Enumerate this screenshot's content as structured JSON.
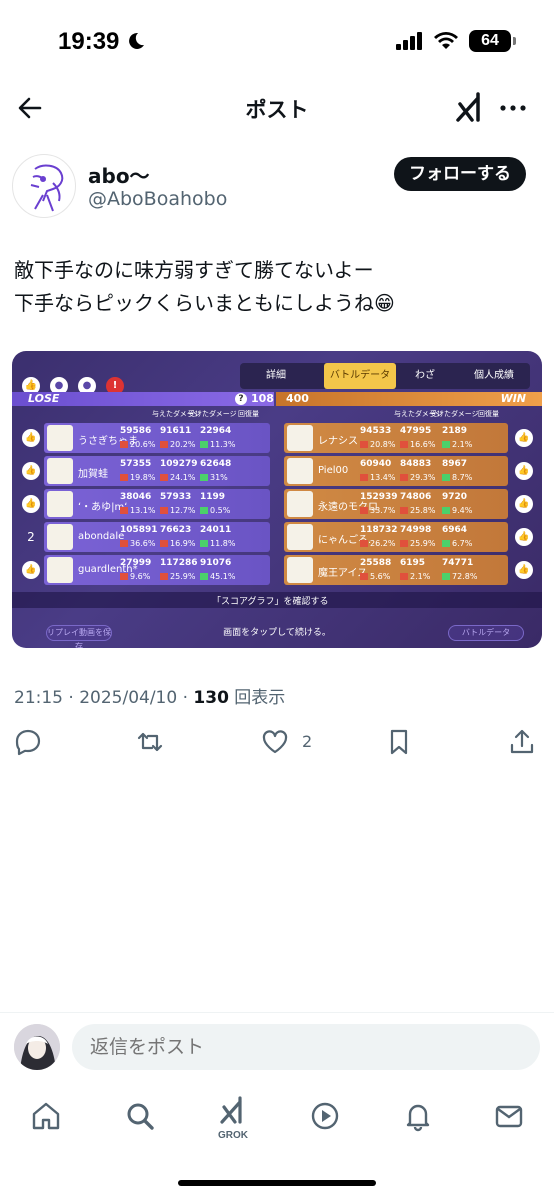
{
  "status": {
    "time": "19:39",
    "battery": "64"
  },
  "nav": {
    "title": "ポスト"
  },
  "author": {
    "name": "abo～",
    "handle": "@AboBoahobo",
    "follow_label": "フォローする"
  },
  "post": {
    "lines": [
      "敵下手なのに味方弱すぎて勝てないよー",
      "下手ならピックくらいまともにしようね😁"
    ]
  },
  "game": {
    "tabs": [
      "詳細",
      "バトルデータ",
      "わざ",
      "個人成績"
    ],
    "lose_label": "LOSE",
    "lose_score": "108",
    "win_score": "400",
    "win_label": "WIN",
    "col_headers": [
      "与えたダメージ",
      "受けたダメージ",
      "回復量"
    ],
    "lose_rows": [
      {
        "name": "うさぎちゃま",
        "v": [
          "59586",
          "91611",
          "22964"
        ],
        "p": [
          "20.6%",
          "20.2%",
          "11.3%"
        ]
      },
      {
        "name": "加賀蛙",
        "v": [
          "57355",
          "109279",
          "62648"
        ],
        "p": [
          "19.8%",
          "24.1%",
          "31%"
        ]
      },
      {
        "name": "ʻ・あゆ|mʻ",
        "v": [
          "38046",
          "57933",
          "1199"
        ],
        "p": [
          "13.1%",
          "12.7%",
          "0.5%"
        ]
      },
      {
        "name": "abondale",
        "v": [
          "105891",
          "76623",
          "24011"
        ],
        "p": [
          "36.6%",
          "16.9%",
          "11.8%"
        ]
      },
      {
        "name": "guardlenth*",
        "v": [
          "27999",
          "117286",
          "91076"
        ],
        "p": [
          "9.6%",
          "25.9%",
          "45.1%"
        ]
      }
    ],
    "win_rows": [
      {
        "name": "レナシス",
        "v": [
          "94533",
          "47995",
          "2189"
        ],
        "p": [
          "20.8%",
          "16.6%",
          "2.1%"
        ]
      },
      {
        "name": "Piel00",
        "v": [
          "60940",
          "84883",
          "8967"
        ],
        "p": [
          "13.4%",
          "29.3%",
          "8.7%"
        ]
      },
      {
        "name": "永遠のモクロ",
        "v": [
          "152939",
          "74806",
          "9720"
        ],
        "p": [
          "33.7%",
          "25.8%",
          "9.4%"
        ]
      },
      {
        "name": "にゃんごろ.",
        "v": [
          "118732",
          "74998",
          "6964"
        ],
        "p": [
          "26.2%",
          "25.9%",
          "6.7%"
        ]
      },
      {
        "name": "魔王アイス",
        "v": [
          "25588",
          "6195",
          "74771"
        ],
        "p": [
          "5.6%",
          "2.1%",
          "72.8%"
        ]
      }
    ],
    "left_rank_2": "2",
    "graph_label": "「スコアグラフ」を確認する",
    "tap_label": "画面をタップして続ける。",
    "save_label": "リプレイ動画を保存",
    "battle_label": "バトルデータ"
  },
  "meta": {
    "time": "21:15 · 2025/04/10 · ",
    "views": "130",
    "views_label": " 回表示"
  },
  "actions": {
    "like_count": "2"
  },
  "reply": {
    "placeholder": "返信をポスト"
  },
  "tabbar": {
    "grok_label": "GROK"
  }
}
